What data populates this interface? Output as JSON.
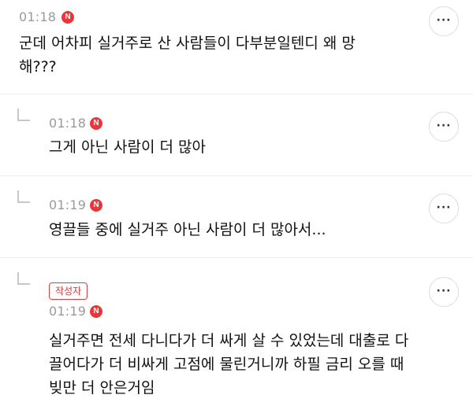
{
  "comments": [
    {
      "time": "01:18",
      "badge": "N",
      "text_lines": [
        "군데 어차피 실거주로 산 사람들이 다부분일텐디 왜 망",
        "해???"
      ],
      "more": "···"
    },
    {
      "time": "01:18",
      "badge": "N",
      "text_lines": [
        "그게 아닌 사람이 더 많아"
      ],
      "more": "···"
    },
    {
      "time": "01:19",
      "badge": "N",
      "text_lines": [
        "영끌들 중에 실거주 아닌 사람이 더 많아서..."
      ],
      "more": "···"
    },
    {
      "author_label": "작성자",
      "time": "01:19",
      "badge": "N",
      "text_lines": [
        "실거주면 전세 다니다가 더 싸게 살 수 있었는데 대출로 다",
        "끌어다가 더 비싸게 고점에 물린거니까 하필 금리 오를 때",
        "빚만 더 안은거임"
      ],
      "more": "···"
    }
  ],
  "colors": {
    "accent_red": "#e8373b",
    "time_gray": "#9a9a9a",
    "divider": "#ececec"
  },
  "icons": {
    "reply": "reply-arrow-icon",
    "more": "more-dots-icon",
    "new": "new-badge-icon"
  }
}
